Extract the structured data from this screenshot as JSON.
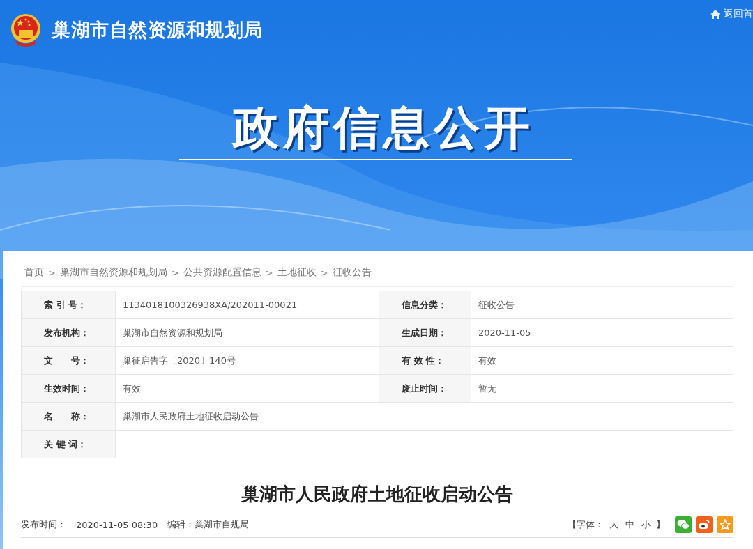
{
  "header": {
    "site_title": "巢湖市自然资源和规划局",
    "home_link": "返回首",
    "banner_title": "政府信息公开"
  },
  "breadcrumb": {
    "separator": ">",
    "items": [
      "首页",
      "巢湖市自然资源和规划局",
      "公共资源配置信息",
      "土地征收",
      "征收公告"
    ]
  },
  "info_table": {
    "rows": [
      [
        {
          "label": "索 引 号：",
          "value": "1134018100326938XA/202011-00021"
        },
        {
          "label": "信息分类：",
          "value": "征收公告"
        }
      ],
      [
        {
          "label": "发布机构：",
          "value": "巢湖市自然资源和规划局"
        },
        {
          "label": "生成日期：",
          "value": "2020-11-05"
        }
      ],
      [
        {
          "label": "文　　号：",
          "value": "巢征启告字〔2020〕140号"
        },
        {
          "label": "有 效 性：",
          "value": "有效"
        }
      ],
      [
        {
          "label": "生效时间：",
          "value": "有效"
        },
        {
          "label": "废止时间：",
          "value": "暂无"
        }
      ],
      [
        {
          "label": "名　　称：",
          "value": "巢湖市人民政府土地征收启动公告"
        }
      ],
      [
        {
          "label": "关 键 词："
        }
      ]
    ]
  },
  "article": {
    "title": "巢湖市人民政府土地征收启动公告",
    "publish_label": "发布时间：",
    "publish_time": "2020-11-05 08:30",
    "editor_label": "编辑：",
    "editor": "巢湖市自规局",
    "font_size": {
      "open": "【字体：",
      "sizes": [
        "大",
        "中",
        "小"
      ],
      "close": "】"
    },
    "share": [
      {
        "kind": "wechat"
      },
      {
        "kind": "weibo"
      },
      {
        "kind": "favorite"
      }
    ]
  }
}
